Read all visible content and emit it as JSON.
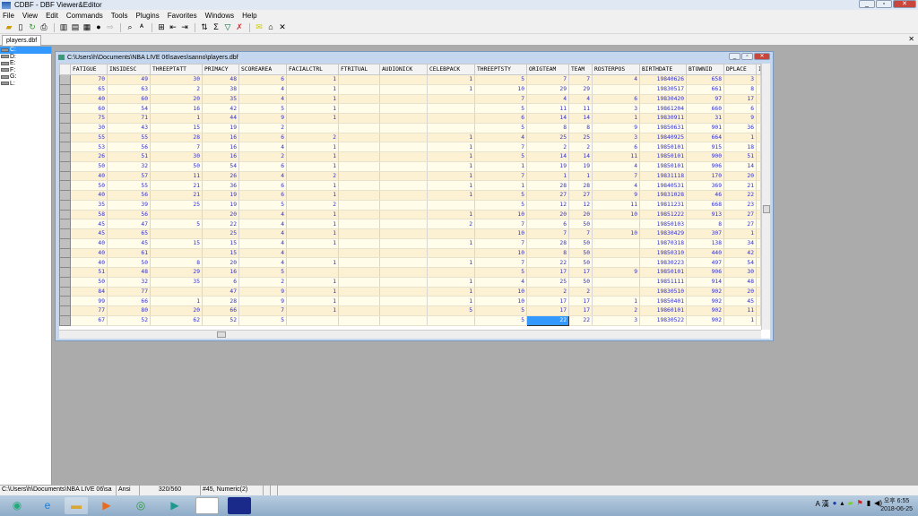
{
  "app": {
    "title": "CDBF - DBF Viewer&Editor"
  },
  "menu": [
    "File",
    "View",
    "Edit",
    "Commands",
    "Tools",
    "Plugins",
    "Favorites",
    "Windows",
    "Help"
  ],
  "tab": {
    "label": "players.dbf",
    "close": "✕"
  },
  "drives": [
    "C:",
    "D:",
    "E:",
    "F:",
    "G:",
    "L:"
  ],
  "child": {
    "title": "C:\\Users\\h\\Documents\\NBA LIVE 06\\saves\\sanno\\players.dbf"
  },
  "table": {
    "columns": [
      "FATIGUE",
      "INSIDESC",
      "THREEPTATT",
      "PRIMACY",
      "SCOREAREA",
      "FACIALCTRL",
      "FTRITUAL",
      "AUDIONICK",
      "CELEBPACK",
      "THREEPTSTY",
      "ORIGTEAM",
      "TEAM",
      "ROSTERPOS",
      "BIRTHDATE",
      "BTOWNID",
      "DPLACE",
      "I"
    ],
    "rows": [
      [
        "70",
        "49",
        "30",
        "48",
        "6",
        "1",
        "",
        "",
        "1",
        "5",
        "7",
        "7",
        "4",
        "19840626",
        "658",
        "3",
        ""
      ],
      [
        "65",
        "63",
        "2",
        "38",
        "4",
        "1",
        "",
        "",
        "1",
        "10",
        "29",
        "29",
        "",
        "19830517",
        "661",
        "8",
        ""
      ],
      [
        "40",
        "60",
        "20",
        "35",
        "4",
        "1",
        "",
        "",
        "",
        "7",
        "4",
        "4",
        "6",
        "19830420",
        "97",
        "17",
        ""
      ],
      [
        "60",
        "54",
        "16",
        "42",
        "5",
        "1",
        "",
        "",
        "",
        "5",
        "11",
        "11",
        "3",
        "19861204",
        "660",
        "6",
        ""
      ],
      [
        "75",
        "71",
        "1",
        "44",
        "9",
        "1",
        "",
        "",
        "",
        "6",
        "14",
        "14",
        "1",
        "19830911",
        "31",
        "9",
        ""
      ],
      [
        "30",
        "43",
        "15",
        "19",
        "2",
        "",
        "",
        "",
        "",
        "5",
        "8",
        "8",
        "9",
        "19850631",
        "901",
        "36",
        ""
      ],
      [
        "55",
        "55",
        "28",
        "16",
        "6",
        "2",
        "",
        "",
        "1",
        "4",
        "25",
        "25",
        "3",
        "19840925",
        "664",
        "1",
        ""
      ],
      [
        "53",
        "56",
        "7",
        "16",
        "4",
        "1",
        "",
        "",
        "1",
        "7",
        "2",
        "2",
        "6",
        "19850101",
        "915",
        "18",
        ""
      ],
      [
        "26",
        "51",
        "30",
        "16",
        "2",
        "1",
        "",
        "",
        "1",
        "5",
        "14",
        "14",
        "11",
        "19850101",
        "900",
        "51",
        ""
      ],
      [
        "50",
        "32",
        "50",
        "54",
        "6",
        "1",
        "",
        "",
        "1",
        "1",
        "19",
        "19",
        "4",
        "19850101",
        "906",
        "14",
        ""
      ],
      [
        "40",
        "57",
        "11",
        "26",
        "4",
        "2",
        "",
        "",
        "1",
        "7",
        "1",
        "1",
        "7",
        "19831118",
        "170",
        "20",
        ""
      ],
      [
        "50",
        "55",
        "21",
        "36",
        "6",
        "1",
        "",
        "",
        "1",
        "1",
        "28",
        "28",
        "4",
        "19840531",
        "369",
        "21",
        ""
      ],
      [
        "40",
        "56",
        "21",
        "19",
        "6",
        "1",
        "",
        "",
        "1",
        "5",
        "27",
        "27",
        "9",
        "19831028",
        "46",
        "22",
        ""
      ],
      [
        "35",
        "39",
        "25",
        "19",
        "5",
        "2",
        "",
        "",
        "",
        "5",
        "12",
        "12",
        "11",
        "19811231",
        "668",
        "23",
        ""
      ],
      [
        "58",
        "56",
        "",
        "20",
        "4",
        "1",
        "",
        "",
        "1",
        "10",
        "20",
        "20",
        "10",
        "19851222",
        "913",
        "27",
        ""
      ],
      [
        "45",
        "47",
        "5",
        "22",
        "4",
        "1",
        "",
        "",
        "2",
        "7",
        "6",
        "50",
        "",
        "19850103",
        "8",
        "27",
        ""
      ],
      [
        "45",
        "65",
        "",
        "25",
        "4",
        "1",
        "",
        "",
        "",
        "10",
        "7",
        "7",
        "10",
        "19830429",
        "307",
        "1",
        ""
      ],
      [
        "40",
        "45",
        "15",
        "15",
        "4",
        "1",
        "",
        "",
        "1",
        "7",
        "28",
        "50",
        "",
        "19870318",
        "138",
        "34",
        ""
      ],
      [
        "40",
        "61",
        "",
        "15",
        "4",
        "",
        "",
        "",
        "",
        "10",
        "8",
        "50",
        "",
        "19850310",
        "440",
        "42",
        ""
      ],
      [
        "40",
        "50",
        "8",
        "20",
        "4",
        "1",
        "",
        "",
        "1",
        "7",
        "22",
        "50",
        "",
        "19830223",
        "497",
        "54",
        ""
      ],
      [
        "51",
        "48",
        "29",
        "16",
        "5",
        "",
        "",
        "",
        "",
        "5",
        "17",
        "17",
        "9",
        "19850101",
        "906",
        "30",
        ""
      ],
      [
        "50",
        "32",
        "35",
        "6",
        "2",
        "1",
        "",
        "",
        "1",
        "4",
        "25",
        "50",
        "",
        "19851111",
        "914",
        "48",
        ""
      ],
      [
        "84",
        "77",
        "",
        "47",
        "9",
        "1",
        "",
        "",
        "1",
        "10",
        "2",
        "2",
        "",
        "19830510",
        "902",
        "20",
        ""
      ],
      [
        "99",
        "66",
        "1",
        "28",
        "9",
        "1",
        "",
        "",
        "1",
        "10",
        "17",
        "17",
        "1",
        "19850401",
        "902",
        "45",
        ""
      ],
      [
        "77",
        "80",
        "20",
        "66",
        "7",
        "1",
        "",
        "",
        "5",
        "5",
        "17",
        "17",
        "2",
        "19860101",
        "902",
        "11",
        ""
      ],
      [
        "67",
        "52",
        "62",
        "52",
        "5",
        "",
        "",
        "",
        "",
        "5",
        "22",
        "22",
        "3",
        "19830522",
        "902",
        "1",
        ""
      ]
    ],
    "selected": {
      "row": 25,
      "col": 10
    }
  },
  "status": {
    "path": "C:\\Users\\h\\Documents\\NBA LIVE 06\\sa",
    "encoding": "Ansi",
    "record": "320/560",
    "field": "#45, Numeric(2)"
  },
  "clock": {
    "time": "오후 6:55",
    "date": "2018-06-25"
  },
  "tray": {
    "ime": "A 漢"
  }
}
